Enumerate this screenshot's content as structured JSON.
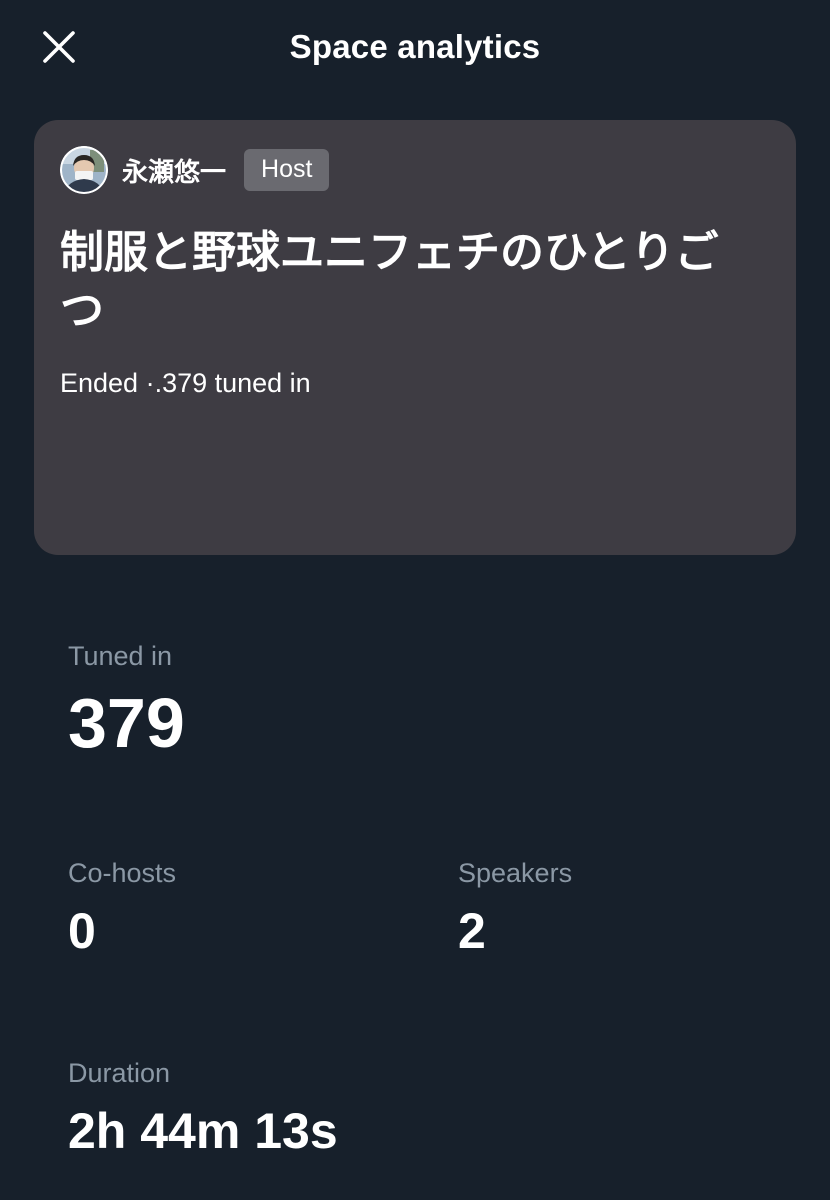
{
  "header": {
    "title": "Space analytics",
    "close_icon": "close-icon"
  },
  "space": {
    "host": {
      "name": "永瀬悠一",
      "badge": "Host",
      "avatar_icon": "user-avatar"
    },
    "title": "制服と野球ユニフェチのひとりごつ",
    "status": "Ended ·.379 tuned in"
  },
  "stats": {
    "tuned_in": {
      "label": "Tuned in",
      "value": "379"
    },
    "co_hosts": {
      "label": "Co-hosts",
      "value": "0"
    },
    "speakers": {
      "label": "Speakers",
      "value": "2"
    },
    "duration": {
      "label": "Duration",
      "value": "2h 44m 13s"
    }
  },
  "colors": {
    "background": "#17202b",
    "card": "#3e3c43",
    "badge": "#6a6a70",
    "muted_text": "#8b98a5",
    "text": "#ffffff"
  }
}
